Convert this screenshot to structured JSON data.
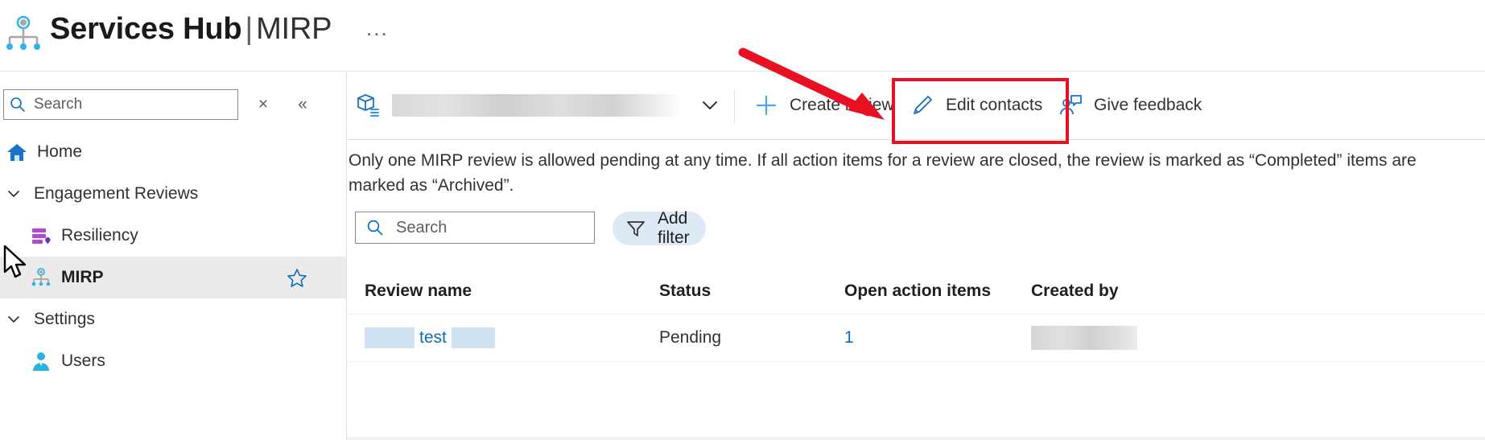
{
  "header": {
    "title_bold": "Services Hub",
    "title_separator": "|",
    "title_thin": "MIRP",
    "overflow_label": "...",
    "brand_icon": "mirp-hierarchy-icon"
  },
  "sidebar": {
    "search": {
      "placeholder": "Search",
      "value": "",
      "icon": "search-icon",
      "clear_label": "×",
      "collapse_label": "«"
    },
    "items": [
      {
        "label": "Home",
        "icon": "home-icon",
        "indent": false,
        "chevron": false,
        "selected": false,
        "star": false
      },
      {
        "label": "Engagement Reviews",
        "icon": "",
        "indent": false,
        "chevron": true,
        "selected": false,
        "star": false
      },
      {
        "label": "Resiliency",
        "icon": "resiliency-icon",
        "indent": true,
        "chevron": false,
        "selected": false,
        "star": false
      },
      {
        "label": "MIRP",
        "icon": "mirp-hierarchy-icon",
        "indent": true,
        "chevron": false,
        "selected": true,
        "star": true
      },
      {
        "label": "Settings",
        "icon": "",
        "indent": false,
        "chevron": true,
        "selected": false,
        "star": false
      },
      {
        "label": "Users",
        "icon": "user-icon",
        "indent": true,
        "chevron": false,
        "selected": false,
        "star": false
      }
    ]
  },
  "commandbar": {
    "scope_icon": "workspace-cube-icon",
    "scope_value": "",
    "scope_chevron": "chevron-down-icon",
    "buttons": [
      {
        "label": "Create review",
        "icon": "plus-icon"
      },
      {
        "label": "Edit contacts",
        "icon": "pencil-icon"
      },
      {
        "label": "Give feedback",
        "icon": "person-feedback-icon"
      }
    ],
    "highlight": {
      "target": "Edit contacts",
      "color": "#e81123"
    },
    "annotation_arrow_color": "#e81123"
  },
  "main": {
    "description": "Only one MIRP review is allowed pending at any time. If all action items for a review are closed, the review is marked as “Completed” items are marked as “Archived”.",
    "search": {
      "placeholder": "Search",
      "value": "",
      "icon": "search-icon"
    },
    "add_filter": {
      "label": "Add filter",
      "icon": "filter-icon",
      "background": "#ddeaf6"
    }
  },
  "table": {
    "columns": [
      "Review name",
      "Status",
      "Open action items",
      "Created by"
    ],
    "rows": [
      {
        "review_name": "test",
        "review_name_redacted": true,
        "status": "Pending",
        "open_action_items": "1",
        "created_by": "",
        "created_by_redacted": true
      }
    ]
  },
  "colors": {
    "accent": "#0f6cbd",
    "highlight": "#e81123",
    "selected_row": "#ebebeb",
    "filter_pill": "#ddeaf6"
  }
}
